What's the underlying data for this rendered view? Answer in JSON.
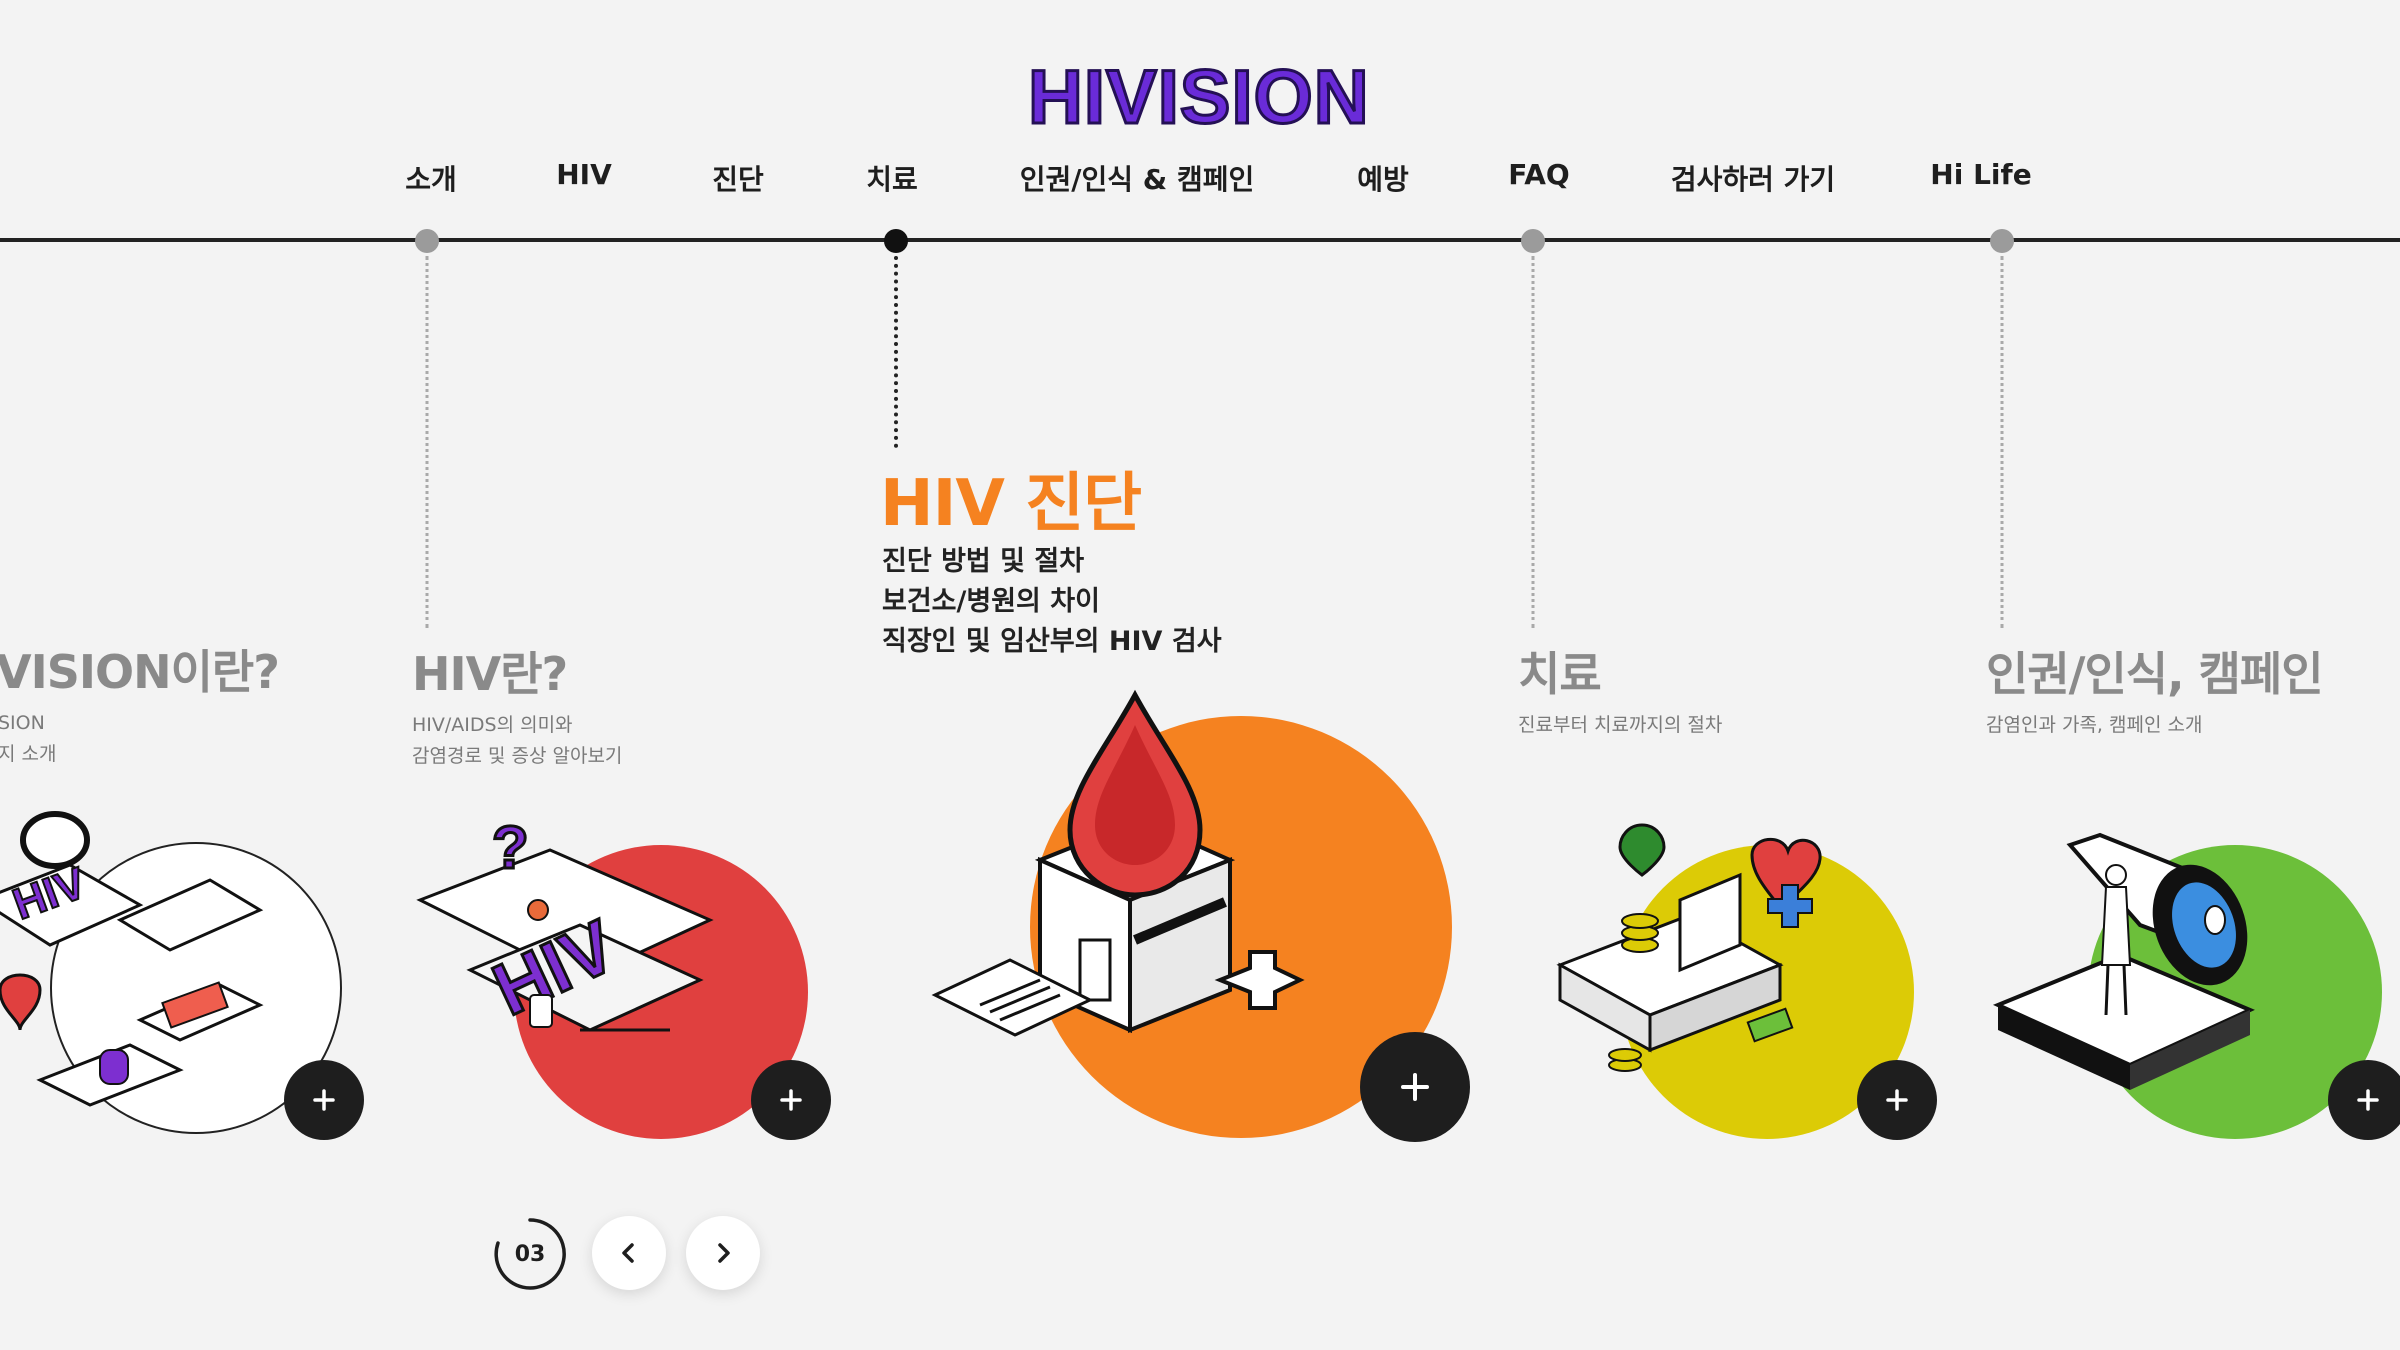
{
  "brand": {
    "logo_text": "HIVISION"
  },
  "nav": [
    {
      "label": "소개"
    },
    {
      "label": "HIV"
    },
    {
      "label": "진단"
    },
    {
      "label": "치료"
    },
    {
      "label": "인권/인식 & 캠페인"
    },
    {
      "label": "예방"
    },
    {
      "label": "FAQ"
    },
    {
      "label": "검사하러 가기"
    },
    {
      "label": "Hi Life"
    }
  ],
  "slides": {
    "intro": {
      "title": "VISION이란?",
      "lines": [
        "SION",
        "지 소개"
      ],
      "color": "#ffffff"
    },
    "hiv": {
      "title": "HIV란?",
      "lines": [
        "HIV/AIDS의 의미와",
        "감염경로 및 증상 알아보기"
      ],
      "color": "#e0403f"
    },
    "diagnosis": {
      "title": "HIV 진단",
      "lines": [
        "진단 방법 및 절차",
        "보건소/병원의 차이",
        "직장인 및 임산부의 HIV 검사"
      ],
      "color": "#f58220"
    },
    "treatment": {
      "title": "치료",
      "lines": [
        "진료부터 치료까지의 절차"
      ],
      "color": "#dccb06"
    },
    "rights": {
      "title": "인권/인식, 캠페인",
      "lines": [
        "감염인과 가족, 캠페인 소개"
      ],
      "color": "#6cbf3a"
    }
  },
  "plus_icon": "plus-icon",
  "slider": {
    "current": "03"
  },
  "colors": {
    "accent": "#f58220",
    "dark": "#1e1e1e",
    "logo": "#6a2bd8"
  }
}
